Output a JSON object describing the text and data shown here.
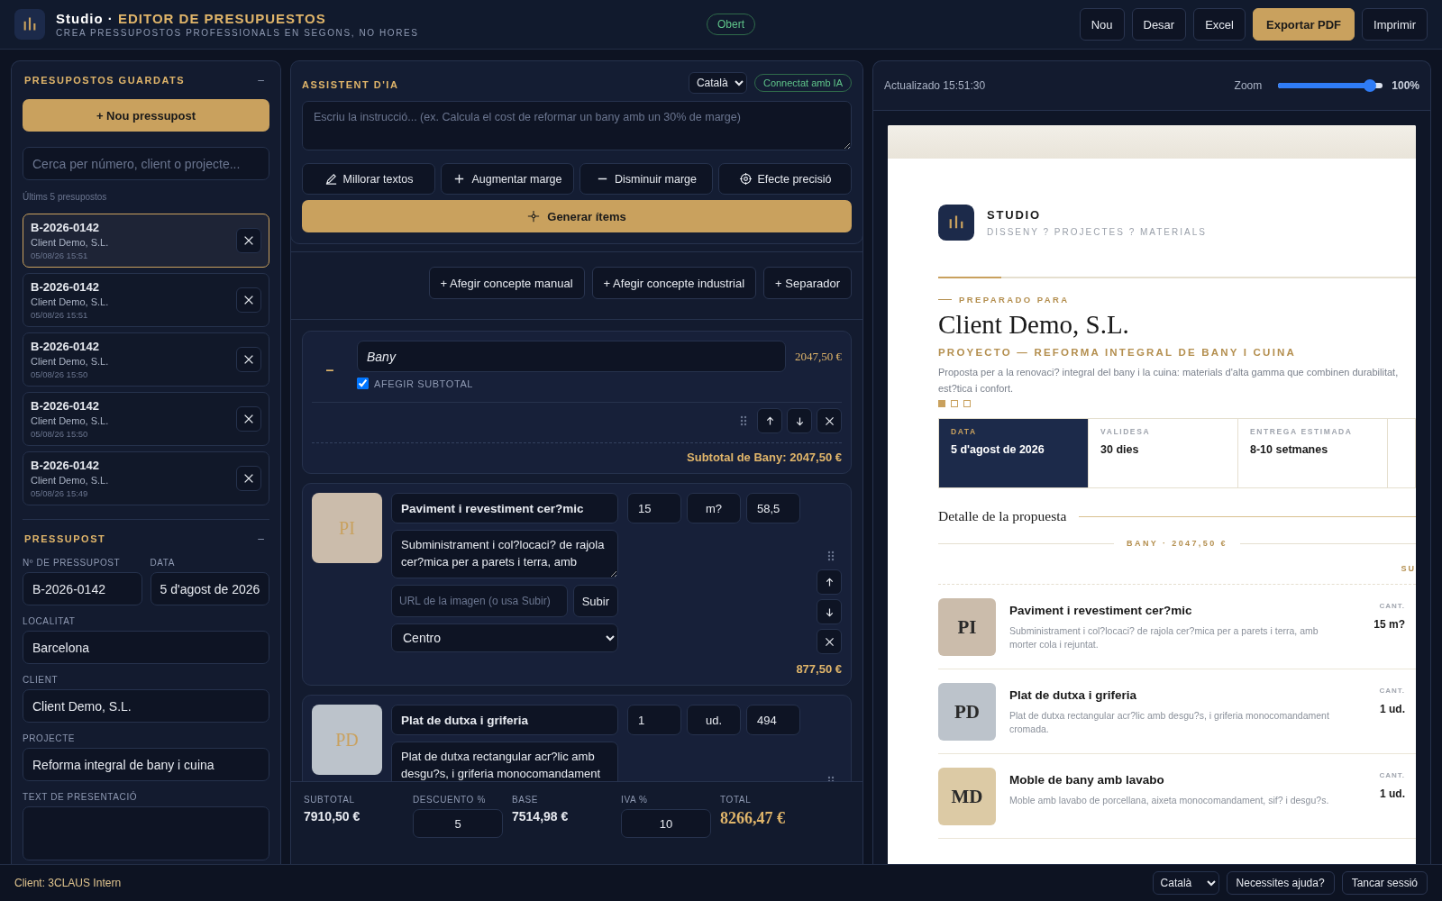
{
  "header": {
    "brand": "Studio ·",
    "title": "EDITOR DE PRESUPUESTOS",
    "subtitle": "CREA PRESSUPOSTOS PROFESSIONALS EN SEGONS, NO HORES",
    "status": "Obert",
    "actions": [
      {
        "label": "Nou",
        "kind": "plain"
      },
      {
        "label": "Desar",
        "kind": "plain"
      },
      {
        "label": "Excel",
        "kind": "plain"
      },
      {
        "label": "Exportar PDF",
        "kind": "primary"
      },
      {
        "label": "Imprimir",
        "kind": "plain"
      }
    ]
  },
  "saved": {
    "title": "PRESUPOSTOS GUARDATS",
    "collapse": "–",
    "new_button": "+ Nou pressupost",
    "search_placeholder": "Cerca per número, client o projecte...",
    "caption": "Últims 5 presupostos",
    "items": [
      {
        "number": "B-2026-0142",
        "client": "Client Demo, S.L.",
        "date": "05/08/26 15:51",
        "selected": true
      },
      {
        "number": "B-2026-0142",
        "client": "Client Demo, S.L.",
        "date": "05/08/26 15:51",
        "selected": false
      },
      {
        "number": "B-2026-0142",
        "client": "Client Demo, S.L.",
        "date": "05/08/26 15:50",
        "selected": false
      },
      {
        "number": "B-2026-0142",
        "client": "Client Demo, S.L.",
        "date": "05/08/26 15:50",
        "selected": false
      },
      {
        "number": "B-2026-0142",
        "client": "Client Demo, S.L.",
        "date": "05/08/26 15:49",
        "selected": false
      }
    ]
  },
  "budget": {
    "title": "PRESSUPOST",
    "collapse": "–",
    "fields": [
      {
        "label": "Nº DE PRESSUPOST",
        "value": "B-2026-0142",
        "kind": "half"
      },
      {
        "label": "DATA",
        "value": "5 d'agost de 2026",
        "kind": "half"
      },
      {
        "label": "LOCALITAT",
        "value": "Barcelona",
        "kind": "full"
      },
      {
        "label": "CLIENT",
        "value": "Client Demo, S.L.",
        "kind": "full"
      },
      {
        "label": "PROJECTE",
        "value": "Reforma integral de bany i cuina",
        "kind": "full"
      },
      {
        "label": "TEXT DE PRESENTACIÓ",
        "kind": "textarea"
      }
    ]
  },
  "assistant": {
    "title": "ASSISTENT D'IA",
    "language": "Català",
    "connection": "Connectat amb IA",
    "prompt_placeholder": "Escriu la instrucció... (ex. Calcula el cost de reformar un bany amb un 30% de marge)",
    "actions": [
      "Millorar textos",
      "Augmentar marge",
      "Disminuir marge",
      "Efecte precisió"
    ],
    "generate": "Generar ítems"
  },
  "editor": {
    "add_buttons": [
      "+ Afegir concepte manual",
      "+ Afegir concepte industrial",
      "+ Separador"
    ],
    "section": {
      "marker": "–",
      "name": "Bany",
      "amount": "2047,50 €",
      "subtotal_option": "AFEGIR SUBTOTAL",
      "show_subtotal": true,
      "subtotal": "Subtotal de Bany: 2047,50 €"
    },
    "items": [
      {
        "initials": "PI",
        "color": "#cbbcab",
        "name": "Paviment i revestiment cer?mic",
        "quantity": "15",
        "unit": "m?",
        "price": "58,5",
        "description": "Subministrament i col?locaci? de rajola cer?mica per a parets i terra, amb",
        "image_placeholder": "URL de la imagen (o usa Subir)",
        "upload": "Subir",
        "alignment": "Centro",
        "total": "877,50 €"
      },
      {
        "initials": "PD",
        "color": "#bcc3cb",
        "name": "Plat de dutxa i griferia",
        "quantity": "1",
        "unit": "ud.",
        "price": "494",
        "description": "Plat de dutxa rectangular acr?lic amb desgu?s, i griferia monocomandament"
      }
    ]
  },
  "totals": [
    {
      "label": "SUBTOTAL",
      "value": "7910,50 €",
      "kind": "text"
    },
    {
      "label": "DESCUENTO %",
      "value": "5",
      "kind": "input"
    },
    {
      "label": "BASE",
      "value": "7514,98 €",
      "kind": "text"
    },
    {
      "label": "IVA %",
      "value": "10",
      "kind": "input"
    },
    {
      "label": "TOTAL",
      "value": "8266,47 €",
      "kind": "total"
    }
  ],
  "preview": {
    "updated": "Actualizado 15:51:30",
    "zoom_label": "Zoom",
    "zoom": {
      "level": 0.88
    },
    "zoom_reading": "100%",
    "studio": "STUDIO",
    "tagline": "DISSENY ? PROJECTES ? MATERIALS",
    "prepared_for": "PREPARADO PARA",
    "client": "Client Demo, S.L.",
    "project": "PROYECTO — REFORMA INTEGRAL DE BANY I CUINA",
    "intro": "Proposta per a la renovaci? integral del bany i la cuina: materials d'alta gamma que combinen durabilitat, est?tica i confort.",
    "pager": [
      {
        "selected": true
      },
      {
        "selected": false
      },
      {
        "selected": false
      }
    ],
    "meta": [
      {
        "label": "DATA",
        "value": "5 d'agost de 2026",
        "highlight": true
      },
      {
        "label": "VALIDESA",
        "value": "30 dies",
        "highlight": false
      },
      {
        "label": "ENTREGA ESTIMADA",
        "value": "8-10 setmanes",
        "highlight": false
      }
    ],
    "detail_title": "Detalle de la propuesta",
    "section_label": "BANY · 2047,50 €",
    "subtotal_label": "SU",
    "items": [
      {
        "initials": "PI",
        "color": "#cbbcab",
        "name": "Paviment i revestiment cer?mic",
        "description": "Subministrament i col?locaci? de rajola cer?mica per a parets i terra, amb morter cola i rejuntat.",
        "quantity_label": "CANT.",
        "quantity": "15 m?"
      },
      {
        "initials": "PD",
        "color": "#bcc3cb",
        "name": "Plat de dutxa i griferia",
        "description": "Plat de dutxa rectangular acr?lic amb desgu?s, i griferia monocomandament cromada.",
        "quantity_label": "CANT.",
        "quantity": "1 ud."
      },
      {
        "initials": "MD",
        "color": "#dccaa5",
        "name": "Moble de bany amb lavabo",
        "description": "Moble amb lavabo de porcellana, aixeta monocomandament, sif? i desgu?s.",
        "quantity_label": "CANT.",
        "quantity": "1 ud."
      }
    ]
  },
  "footer": {
    "client": "Client: 3CLAUS Intern",
    "language": "Català",
    "help": "Necessites ajuda?",
    "logout": "Tancar sessió"
  }
}
